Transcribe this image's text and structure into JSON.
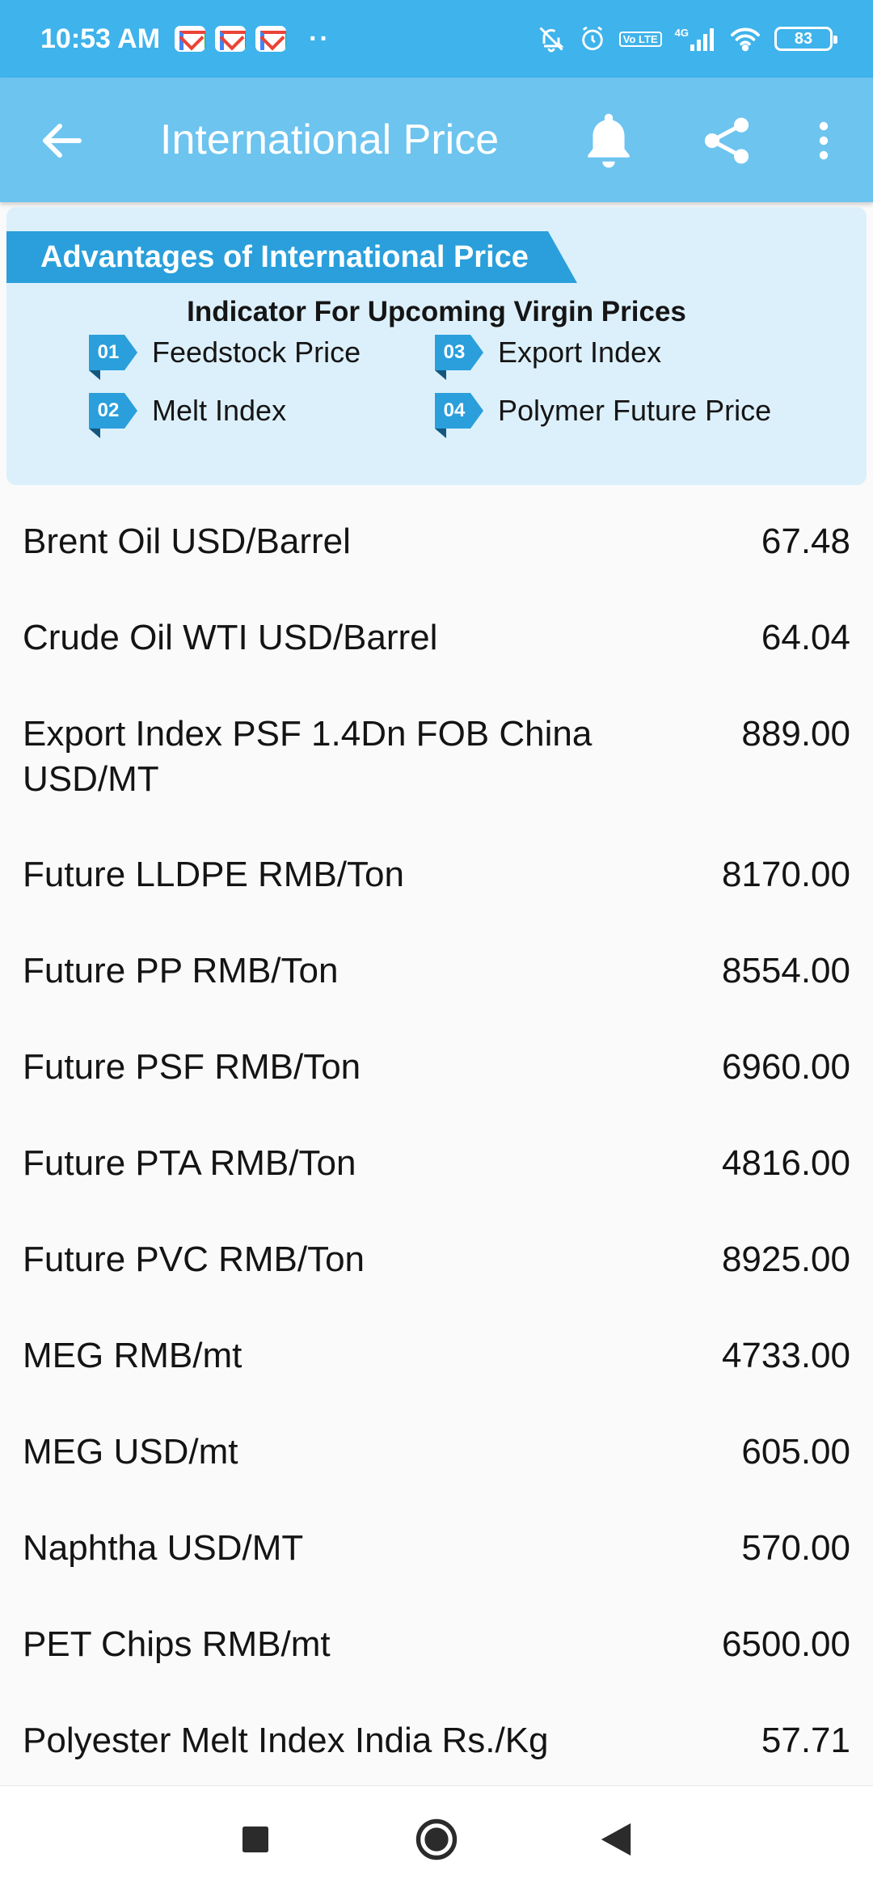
{
  "status_bar": {
    "time": "10:53 AM",
    "notification_icons": [
      "gmail-icon",
      "gmail-icon",
      "gmail-icon"
    ],
    "more_indicator": "··",
    "network_label": "4G",
    "volte_label": "Vo LTE",
    "battery_level": "83"
  },
  "toolbar": {
    "title": "International Price",
    "back_icon": "arrow-left-icon",
    "bell_icon": "bell-icon",
    "share_icon": "share-icon",
    "more_icon": "more-vert-icon"
  },
  "banner": {
    "heading": "Advantages of International Price",
    "subheading": "Indicator For Upcoming Virgin Prices",
    "items": [
      {
        "num": "01",
        "label": "Feedstock Price"
      },
      {
        "num": "02",
        "label": "Melt Index"
      },
      {
        "num": "03",
        "label": "Export Index"
      },
      {
        "num": "04",
        "label": "Polymer Future Price"
      }
    ]
  },
  "prices": [
    {
      "name": "Brent Oil USD/Barrel",
      "value": "67.48"
    },
    {
      "name": "Crude Oil WTI USD/Barrel",
      "value": "64.04"
    },
    {
      "name": "Export Index PSF 1.4Dn FOB China USD/MT",
      "value": "889.00"
    },
    {
      "name": "Future LLDPE RMB/Ton",
      "value": "8170.00"
    },
    {
      "name": "Future PP RMB/Ton",
      "value": "8554.00"
    },
    {
      "name": "Future PSF RMB/Ton",
      "value": "6960.00"
    },
    {
      "name": "Future PTA RMB/Ton",
      "value": "4816.00"
    },
    {
      "name": "Future PVC RMB/Ton",
      "value": "8925.00"
    },
    {
      "name": "MEG RMB/mt",
      "value": "4733.00"
    },
    {
      "name": "MEG USD/mt",
      "value": "605.00"
    },
    {
      "name": "Naphtha USD/MT",
      "value": "570.00"
    },
    {
      "name": "PET Chips RMB/mt",
      "value": "6500.00"
    },
    {
      "name": "Polyester Melt Index India Rs./Kg",
      "value": "57.71"
    }
  ],
  "nav_bar": {
    "recents_icon": "square-icon",
    "home_icon": "circle-icon",
    "back_icon": "triangle-back-icon"
  },
  "colors": {
    "status_bar": "#3fb3eb",
    "toolbar": "#6cc4ef",
    "banner_bg": "#dcf0fb",
    "accent": "#2a9fdb"
  }
}
